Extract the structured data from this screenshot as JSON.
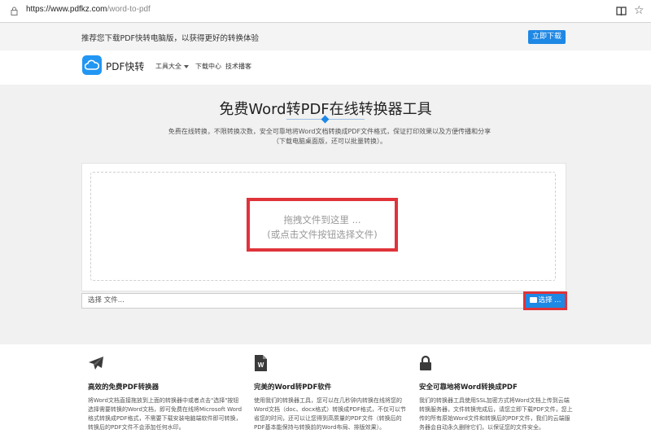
{
  "browser": {
    "url_host": "https://www.pdfkz.com",
    "url_path": "/word-to-pdf"
  },
  "promo": {
    "text": "推荐您下载PDF快转电脑版，以获得更好的转换体验",
    "button": "立即下载"
  },
  "nav": {
    "brand": "PDF快转",
    "items": [
      {
        "label": "工具大全",
        "has_caret": true
      },
      {
        "label": "下载中心"
      },
      {
        "label": "技术播客"
      }
    ]
  },
  "hero": {
    "title": "免费Word转PDF在线转换器工具",
    "desc": "免费在线转换，不限转换次数，安全可靠地将Word文档转换成PDF文件格式，保证打印效果以及方便传播和分享（下载电脑桌面版，还可以批量转换）。"
  },
  "upload": {
    "drop_line1": "拖拽文件到这里 ...",
    "drop_line2": "(或点击文件按钮选择文件)",
    "file_placeholder": "选择 文件...",
    "choose_button": "选择 ..."
  },
  "features": [
    {
      "icon": "paper-plane-icon",
      "title": "高效的免费PDF转换器",
      "text": "将Word文档直接拖放到上面的转换器中或者点击\"选择\"按钮选择需要转换的Word文档，即可免费在线将Microsoft Word格式转换成PDF格式，不需要下载安装电脑端软件即可转换，转换后的PDF文件不会添加任何水印。"
    },
    {
      "icon": "word-file-icon",
      "title": "完美的Word转PDF软件",
      "text": "使用我们的转换器工具，您可以在几秒钟内转换在线将您的Word文档（doc、docx格式）转换成PDF格式，不仅可以节省您的时间，还可以让您得到高质量的PDF文件（转换后的PDF基本能保持与转换前的Word布局、排版效果）。"
    },
    {
      "icon": "lock-icon",
      "title": "安全可靠地将Word转换成PDF",
      "text": "我们的转换器工具使用SSL加密方式将Word文档上传到云端转换服务器，文件转换完成后，请您立即下载PDF文件，您上传的所有原始Word文件和转换后的PDF文件，我们的云端服务器会自动永久删除它们，以保证您的文件安全。"
    }
  ],
  "colors": {
    "accent": "#1e88e5",
    "highlight": "#e0333a"
  }
}
